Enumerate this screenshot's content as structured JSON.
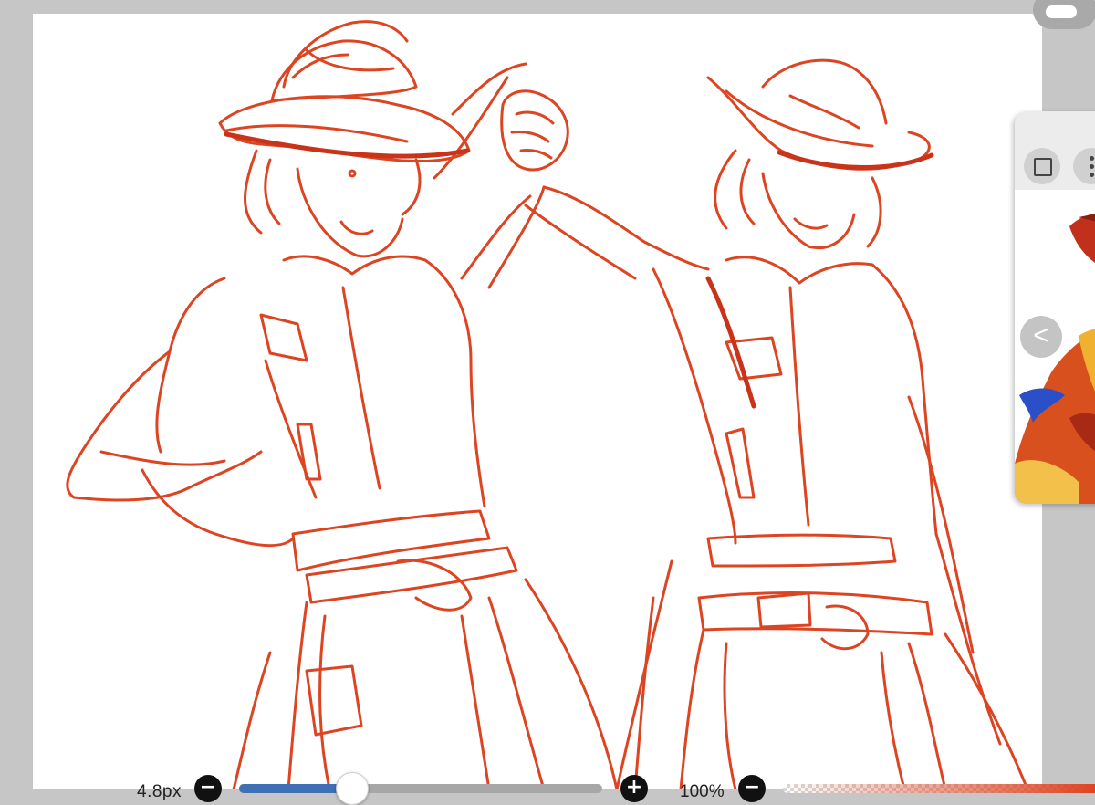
{
  "canvas": {
    "background": "#ffffff",
    "stroke_color": "#dd4422"
  },
  "reference_panel": {
    "toolbar_icons": [
      "square-icon",
      "more-vertical-icon"
    ],
    "collapse_icon": "chevron-left-icon",
    "collapse_glyph": "<"
  },
  "brush": {
    "size_label": "4.8px",
    "size_fraction": 0.31,
    "decrease_glyph": "−",
    "increase_glyph": "+",
    "track_color": "#a7a7a7",
    "fill_color": "#3f6fb5"
  },
  "opacity": {
    "label": "100%",
    "value": 1.0,
    "decrease_glyph": "−"
  }
}
